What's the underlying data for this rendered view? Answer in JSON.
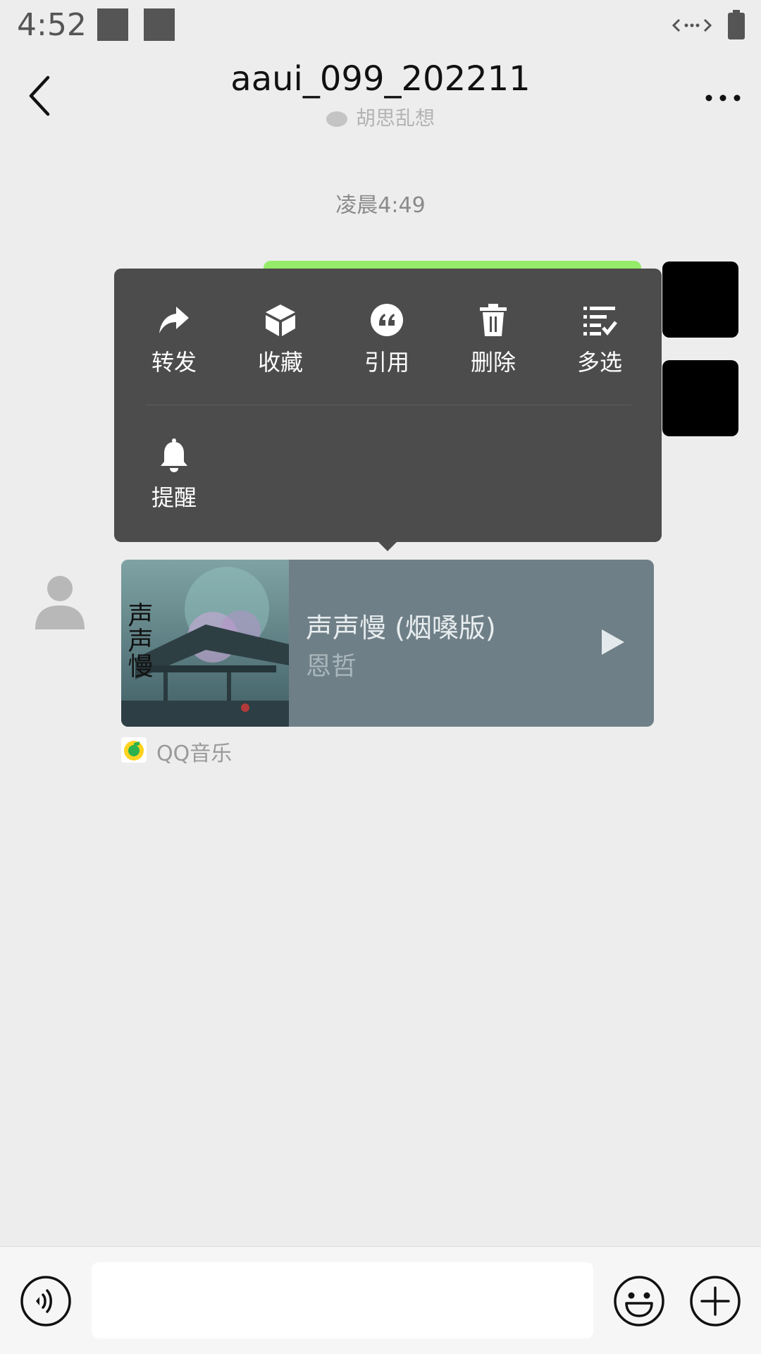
{
  "status_bar": {
    "time": "4:52"
  },
  "header": {
    "title": "aaui_099_202211",
    "subtitle": "胡思乱想"
  },
  "chat": {
    "timestamp": "凌晨4:49",
    "context_menu": {
      "items": [
        {
          "label": "转发",
          "icon": "forward-icon"
        },
        {
          "label": "收藏",
          "icon": "favorite-icon"
        },
        {
          "label": "引用",
          "icon": "quote-icon"
        },
        {
          "label": "删除",
          "icon": "delete-icon"
        },
        {
          "label": "多选",
          "icon": "multi-select-icon"
        },
        {
          "label": "提醒",
          "icon": "remind-icon"
        }
      ]
    },
    "music_card": {
      "title": "声声慢 (烟嗓版)",
      "artist": "恩哲",
      "album_art_text": "声声慢",
      "source": "QQ音乐"
    }
  },
  "input_bar": {
    "placeholder": ""
  },
  "colors": {
    "background": "#ededed",
    "menu": "#4c4c4c",
    "card": "#6f7f87",
    "bubble_green": "#95ec69"
  }
}
